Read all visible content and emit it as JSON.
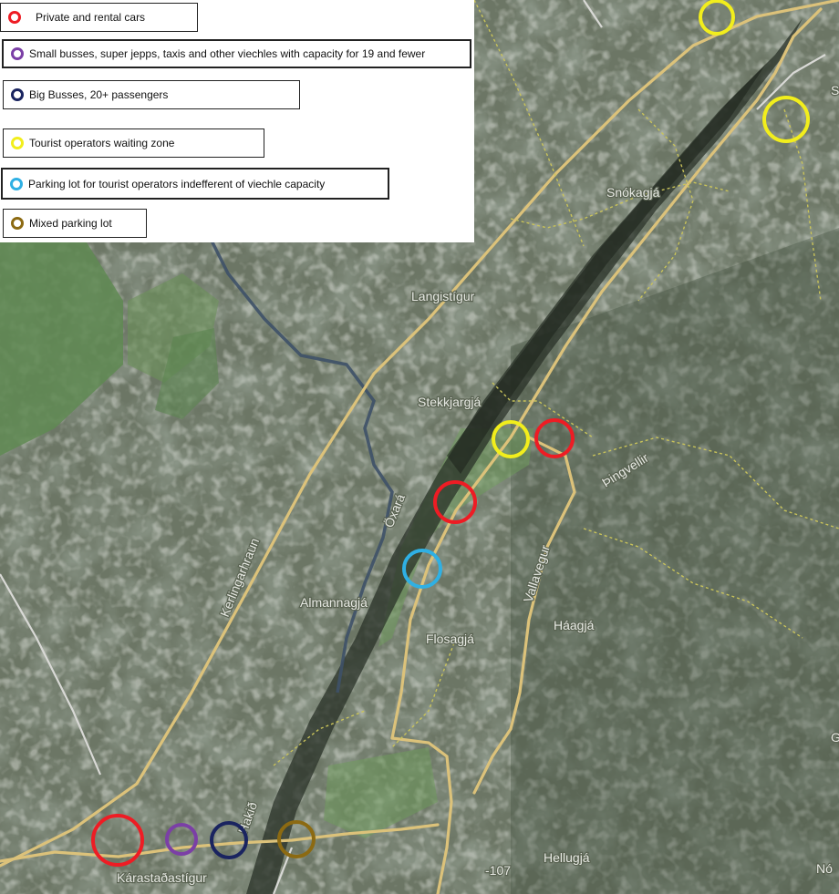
{
  "legend": {
    "items": [
      {
        "label": "Private and rental cars",
        "color": "#ee1c24"
      },
      {
        "label": "Small busses, super jepps, taxis and other viechles with capacity for 19 and fewer",
        "color": "#7b3fa6"
      },
      {
        "label": "Big Busses, 20+ passengers",
        "color": "#1a2460"
      },
      {
        "label": "Tourist operators waiting zone",
        "color": "#f2ee1c"
      },
      {
        "label": "Parking lot for tourist operators indefferent of viechle capacity",
        "color": "#2fb0e4"
      },
      {
        "label": "Mixed parking lot",
        "color": "#8c6a12"
      }
    ]
  },
  "map_labels": {
    "snokagja": "Snókagjá",
    "langistigur": "Langistígur",
    "stekkjargja": "Stekkjargjá",
    "pingvellir": "Þingvellir",
    "oxara": "Öxará",
    "kerlingarhraun": "Kerlingarhraun",
    "almannagja": "Almannagjá",
    "flosagja": "Flosagjá",
    "vallavegur": "Vallavegur",
    "haagja": "Háagjá",
    "hellugja": "Hellugjá",
    "karastadastigur": "Kárastaðastígur",
    "haki": "Hakið",
    "road_107": "-107",
    "edge_s": "S",
    "edge_g": "G",
    "edge_no": "Nó"
  },
  "markers": [
    {
      "id": "marker-yellow-top",
      "color": "#f2ee1c"
    },
    {
      "id": "marker-yellow-ne",
      "color": "#f2ee1c"
    },
    {
      "id": "marker-yellow-center",
      "color": "#f2ee1c"
    },
    {
      "id": "marker-red-center-right",
      "color": "#ee1c24"
    },
    {
      "id": "marker-red-center",
      "color": "#ee1c24"
    },
    {
      "id": "marker-blue-center",
      "color": "#2fb0e4"
    },
    {
      "id": "marker-red-bottom",
      "color": "#ee1c24"
    },
    {
      "id": "marker-purple-bottom",
      "color": "#7b3fa6"
    },
    {
      "id": "marker-navy-bottom",
      "color": "#1a2460"
    },
    {
      "id": "marker-brown-bottom",
      "color": "#8c6a12"
    }
  ]
}
